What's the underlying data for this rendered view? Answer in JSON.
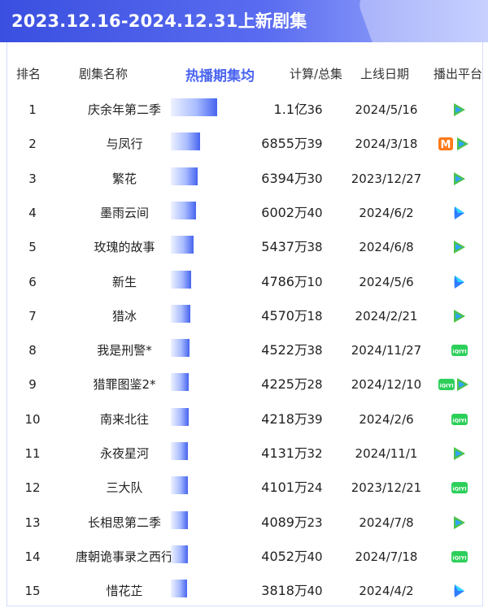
{
  "title": "2023.12.16-2024.12.31上新剧集",
  "headers": {
    "rank": "排名",
    "name": "剧集名称",
    "metric": "热播期集均",
    "episodes": "计算/总集",
    "date": "上线日期",
    "platform": "播出平台"
  },
  "chart_data": {
    "type": "bar",
    "title": "2023.12.16-2024.12.31上新剧集",
    "categories": [
      "庆余年第二季",
      "与凤行",
      "繁花",
      "墨雨云间",
      "玫瑰的故事",
      "新生",
      "猎冰",
      "我是刑警*",
      "猎罪图鉴2*",
      "南来北往",
      "永夜星河",
      "三大队",
      "长相思第二季",
      "唐朝诡事录之西行",
      "惜花芷"
    ],
    "values": [
      11000,
      6855,
      6394,
      6002,
      5437,
      4786,
      4570,
      4522,
      4225,
      4218,
      4131,
      4101,
      4089,
      4052,
      3818
    ],
    "value_unit": "万"
  },
  "rows": [
    {
      "rank": "1",
      "name": "庆余年第二季",
      "value": "1.1亿",
      "episodes": "36",
      "date": "2024/5/16",
      "platforms": [
        "tencent"
      ]
    },
    {
      "rank": "2",
      "name": "与凤行",
      "value": "6855万",
      "episodes": "39",
      "date": "2024/3/18",
      "platforms": [
        "mango",
        "tencent"
      ]
    },
    {
      "rank": "3",
      "name": "繁花",
      "value": "6394万",
      "episodes": "30",
      "date": "2023/12/27",
      "platforms": [
        "tencent"
      ]
    },
    {
      "rank": "4",
      "name": "墨雨云间",
      "value": "6002万",
      "episodes": "40",
      "date": "2024/6/2",
      "platforms": [
        "youku"
      ]
    },
    {
      "rank": "5",
      "name": "玫瑰的故事",
      "value": "5437万",
      "episodes": "38",
      "date": "2024/6/8",
      "platforms": [
        "tencent"
      ]
    },
    {
      "rank": "6",
      "name": "新生",
      "value": "4786万",
      "episodes": "10",
      "date": "2024/5/6",
      "platforms": [
        "youku"
      ]
    },
    {
      "rank": "7",
      "name": "猎冰",
      "value": "4570万",
      "episodes": "18",
      "date": "2024/2/21",
      "platforms": [
        "tencent"
      ]
    },
    {
      "rank": "8",
      "name": "我是刑警*",
      "value": "4522万",
      "episodes": "38",
      "date": "2024/11/27",
      "platforms": [
        "iqiyi"
      ]
    },
    {
      "rank": "9",
      "name": "猎罪图鉴2*",
      "value": "4225万",
      "episodes": "28",
      "date": "2024/12/10",
      "platforms": [
        "iqiyi",
        "tencent"
      ]
    },
    {
      "rank": "10",
      "name": "南来北往",
      "value": "4218万",
      "episodes": "39",
      "date": "2024/2/6",
      "platforms": [
        "iqiyi"
      ]
    },
    {
      "rank": "11",
      "name": "永夜星河",
      "value": "4131万",
      "episodes": "32",
      "date": "2024/11/1",
      "platforms": [
        "tencent"
      ]
    },
    {
      "rank": "12",
      "name": "三大队",
      "value": "4101万",
      "episodes": "24",
      "date": "2023/12/21",
      "platforms": [
        "iqiyi"
      ]
    },
    {
      "rank": "13",
      "name": "长相思第二季",
      "value": "4089万",
      "episodes": "23",
      "date": "2024/7/8",
      "platforms": [
        "tencent"
      ]
    },
    {
      "rank": "14",
      "name": "唐朝诡事录之西行",
      "value": "4052万",
      "episodes": "40",
      "date": "2024/7/18",
      "platforms": [
        "iqiyi"
      ]
    },
    {
      "rank": "15",
      "name": "惜花芷",
      "value": "3818万",
      "episodes": "40",
      "date": "2024/4/2",
      "platforms": [
        "youku"
      ]
    }
  ],
  "icons": {
    "tencent": {
      "name": "tencent-video-icon",
      "color": "#4cc24a",
      "accent": "#2fa3ff"
    },
    "youku": {
      "name": "youku-icon",
      "color": "#2f7dff",
      "accent": "#2fd6ff"
    },
    "iqiyi": {
      "name": "iqiyi-icon",
      "color": "#2ccf5a",
      "label": "iQIYI"
    },
    "mango": {
      "name": "mango-tv-icon",
      "color": "#ff7a1a",
      "label": "M"
    }
  },
  "colors": {
    "accent": "#4a64f0"
  }
}
